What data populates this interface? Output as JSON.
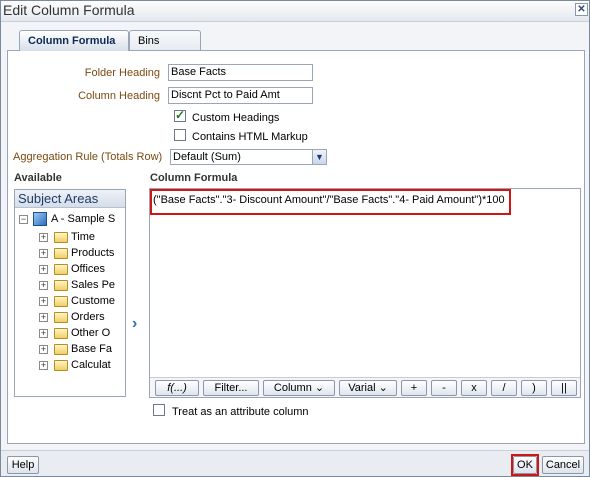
{
  "window": {
    "title": "Edit Column Formula",
    "close_glyph": "✕"
  },
  "tabs": [
    {
      "label": "Column Formula"
    },
    {
      "label": "Bins"
    }
  ],
  "form": {
    "folder_heading_label": "Folder Heading",
    "folder_heading_value": "Base Facts",
    "column_heading_label": "Column Heading",
    "column_heading_value": "Discnt Pct to Paid Amt",
    "custom_headings_label": "Custom Headings",
    "custom_headings_checked": true,
    "contains_html_label": "Contains HTML Markup",
    "contains_html_checked": false,
    "aggregation_label": "Aggregation Rule (Totals Row)",
    "aggregation_value": "Default (Sum)"
  },
  "available": {
    "title": "Available",
    "subject_areas_title": "Subject Areas",
    "root": "A - Sample S",
    "folders": [
      "Time",
      "Products",
      "Offices",
      "Sales Pe",
      "Custome",
      "Orders",
      "Other O",
      "Base Fa",
      "Calculat"
    ]
  },
  "formula": {
    "title": "Column Formula",
    "text": "(\"Base Facts\".\"3- Discount Amount\"/\"Base Facts\".\"4- Paid Amount\")*100",
    "toolbar": [
      "f(...)",
      "Filter...",
      "Column ⌄",
      "Varial ⌄",
      "+",
      "-",
      "x",
      "/",
      ")",
      "||"
    ]
  },
  "attribute_column_label": "Treat as an attribute column",
  "buttons": {
    "help": "Help",
    "ok": "OK",
    "cancel": "Cancel"
  },
  "colors": {
    "highlight": "#d11515",
    "label": "#7a4a12",
    "accent": "#2a6fb8"
  }
}
